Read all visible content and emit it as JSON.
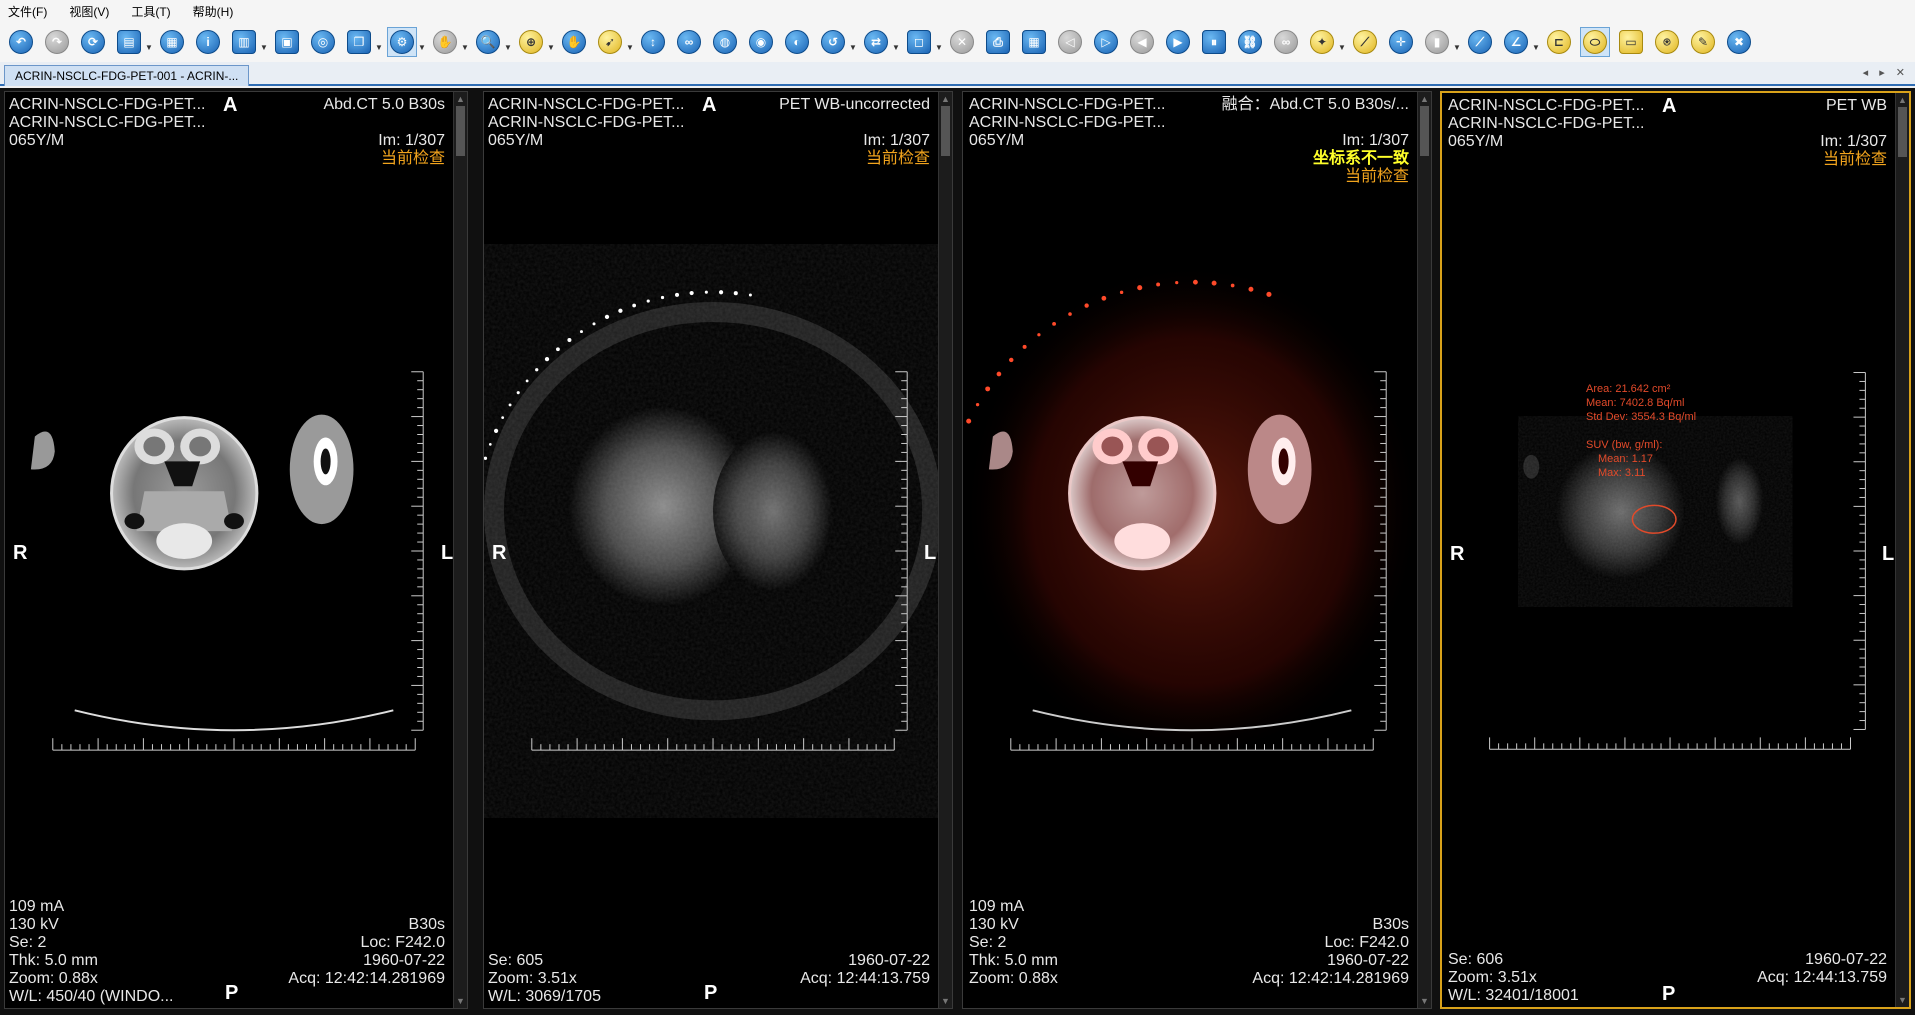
{
  "menu": {
    "file": "文件(F)",
    "view": "视图(V)",
    "tools": "工具(T)",
    "help": "帮助(H)"
  },
  "toolbar_icons": [
    "undo-icon",
    "redo-icon",
    "refresh-icon",
    "clipboard-icon",
    "series-icon",
    "info-icon",
    "layout-icon",
    "tile-icon",
    "film-icon",
    "stack-icon",
    "gear-icon",
    "hand-disabled-icon",
    "zoom-icon",
    "magnify-icon",
    "pan-icon",
    "pointer-icon",
    "probe-icon",
    "cells-icon",
    "globe-icon",
    "globe2-icon",
    "contrast-icon",
    "rotate-icon",
    "sync-icon",
    "roi-icon",
    "close-icon",
    "print-icon",
    "grid-icon",
    "prev-icon",
    "next-icon",
    "back-icon",
    "play-icon",
    "pause-icon",
    "link-icon",
    "chain-icon",
    "bulb-icon",
    "ruler-icon",
    "crosshair-icon",
    "disabled-icon",
    "line-icon",
    "angle-icon",
    "measure-icon",
    "ellipse-icon",
    "rect-icon",
    "stamp-icon",
    "pen-icon",
    "clear-icon"
  ],
  "tab": {
    "label": "ACRIN-NSCLC-FDG-PET-001  -  ACRIN-...",
    "nav": "◂ ▸ ✕"
  },
  "viewports": [
    {
      "id": "ct",
      "patient_line1": "ACRIN-NSCLC-FDG-PET...",
      "patient_line2": "ACRIN-NSCLC-FDG-PET...",
      "age_sex": "065Y/M",
      "series_desc": "Abd.CT 5.0 B30s",
      "image_index": "Im: 1/307",
      "current_exam": "当前检查",
      "orient_top": "A",
      "orient_left": "R",
      "orient_right": "L",
      "orient_bottom": "P",
      "bl": [
        "109 mA",
        "130 kV",
        "Se: 2",
        "Thk: 5.0 mm",
        "Zoom: 0.88x",
        "W/L: 450/40  (WINDO..."
      ],
      "br": [
        "B30s",
        "Loc: F242.0",
        "1960-07-22",
        "Acq: 12:42:14.281969"
      ]
    },
    {
      "id": "pet-unc",
      "patient_line1": "ACRIN-NSCLC-FDG-PET...",
      "patient_line2": "ACRIN-NSCLC-FDG-PET...",
      "age_sex": "065Y/M",
      "series_desc": "PET WB-uncorrected",
      "image_index": "Im: 1/307",
      "current_exam": "当前检查",
      "orient_top": "A",
      "orient_left": "R",
      "orient_right": "L",
      "orient_bottom": "P",
      "bl": [
        "Se: 605",
        "Zoom: 3.51x",
        "W/L: 3069/1705"
      ],
      "br": [
        "1960-07-22",
        "Acq: 12:44:13.759"
      ]
    },
    {
      "id": "fusion",
      "patient_line1": "ACRIN-NSCLC-FDG-PET...",
      "patient_line2": "ACRIN-NSCLC-FDG-PET...",
      "age_sex": "065Y/M",
      "series_desc": "融合：Abd.CT 5.0 B30s/...",
      "image_index": "Im: 1/307",
      "warning": "坐标系不一致",
      "current_exam": "当前检查",
      "orient_top": "",
      "orient_left": "",
      "orient_right": "",
      "orient_bottom": "",
      "bl": [
        "109 mA",
        "130 kV",
        "Se: 2",
        "Thk: 5.0 mm",
        "Zoom: 0.88x"
      ],
      "br": [
        "B30s",
        "Loc: F242.0",
        "1960-07-22",
        "Acq: 12:42:14.281969"
      ]
    },
    {
      "id": "pet-wb",
      "patient_line1": "ACRIN-NSCLC-FDG-PET...",
      "patient_line2": "ACRIN-NSCLC-FDG-PET...",
      "age_sex": "065Y/M",
      "series_desc": "PET WB",
      "image_index": "Im: 1/307",
      "current_exam": "当前检查",
      "orient_top": "A",
      "orient_left": "R",
      "orient_right": "L",
      "orient_bottom": "P",
      "bl": [
        "Se: 606",
        "Zoom: 3.51x",
        "W/L: 32401/18001"
      ],
      "br": [
        "1960-07-22",
        "Acq: 12:44:13.759"
      ],
      "roi": {
        "area": "Area: 21.642 cm²",
        "mean": "Mean: 7402.8 Bq/ml",
        "std": "Std Dev: 3554.3 Bq/ml",
        "suv_title": "SUV (bw, g/ml):",
        "suv_mean": "Mean: 1.17",
        "suv_max": "Max: 3.11"
      }
    }
  ],
  "colors": {
    "accent": "#2f6db4",
    "selected_border": "#d9a21a",
    "overlay_text": "#e8e8e8",
    "current_exam": "#f2a41d",
    "warning": "#ffff2a",
    "roi": "#e24a2a"
  }
}
